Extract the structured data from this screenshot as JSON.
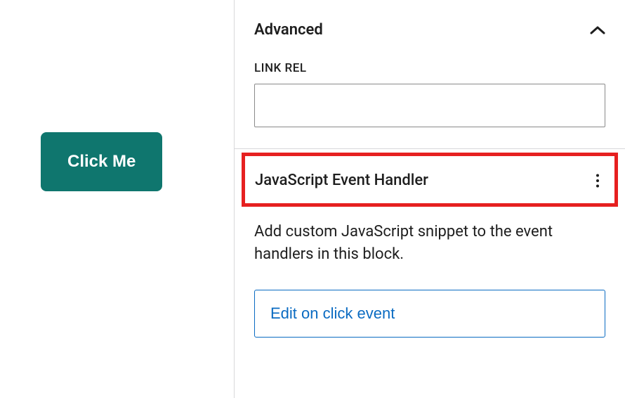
{
  "canvas": {
    "button_label": "Click Me"
  },
  "sidebar": {
    "advanced": {
      "title": "Advanced",
      "link_rel": {
        "label": "LINK REL",
        "value": ""
      }
    },
    "js_handler": {
      "title": "JavaScript Event Handler",
      "description": "Add custom JavaScript snippet to the event handlers in this block.",
      "edit_button_label": "Edit on click event"
    }
  }
}
